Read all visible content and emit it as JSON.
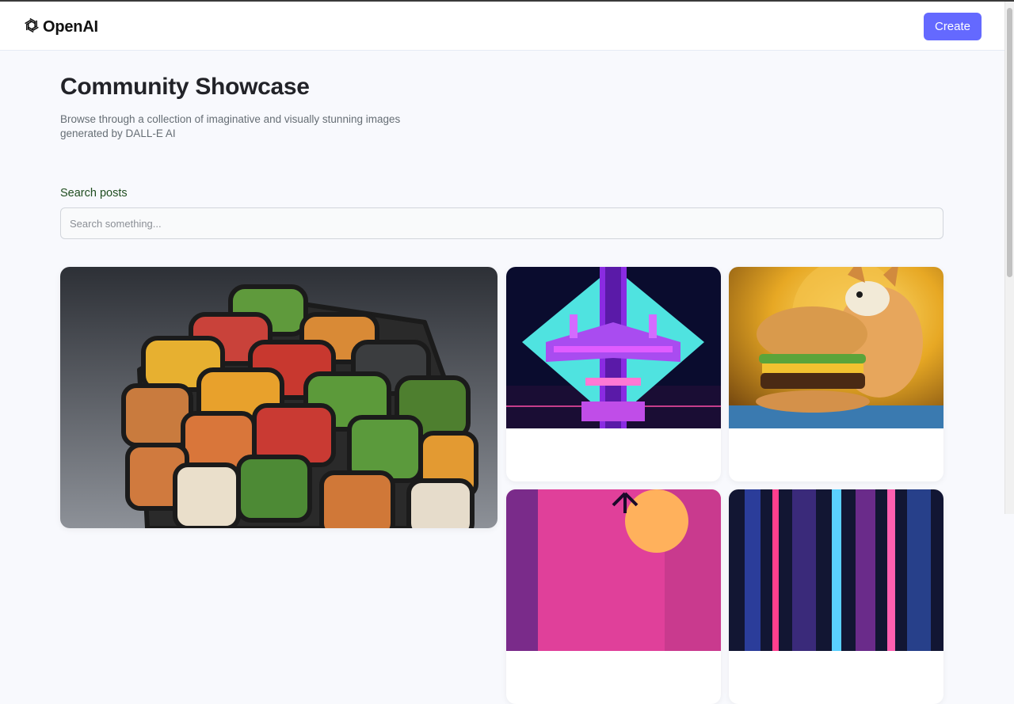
{
  "header": {
    "brand": "OpenAI",
    "logo_icon": "openai-logo-icon",
    "create_label": "Create"
  },
  "hero": {
    "title": "Community Showcase",
    "subtitle": "Browse through a collection of imaginative and visually stunning images generated by DALL-E AI"
  },
  "search": {
    "label": "Search posts",
    "placeholder": "Search something...",
    "value": ""
  },
  "colors": {
    "accent": "#6469ff",
    "background": "#f8f9fd",
    "title": "#222328",
    "subtitle": "#666e75"
  },
  "gallery": {
    "cards": [
      {
        "id": "rubiks-cube-food"
      },
      {
        "id": "neon-pixel-spaceship"
      },
      {
        "id": "shiba-dog-burger"
      },
      {
        "id": "synthwave-palm-sunset"
      },
      {
        "id": "neon-city-street"
      }
    ]
  }
}
